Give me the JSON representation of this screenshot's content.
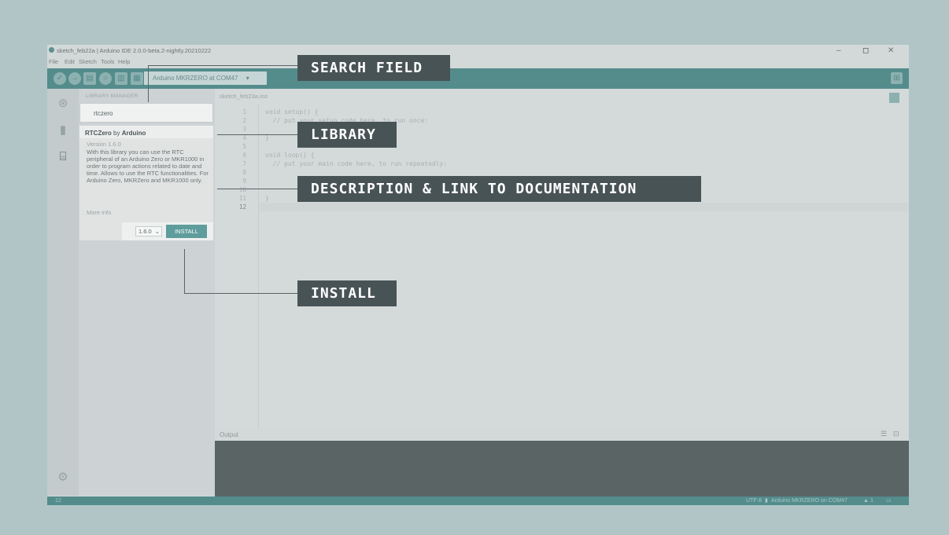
{
  "window": {
    "title": "sketch_feb22a | Arduino IDE 2.0.0-beta.2-nightly.20210222",
    "controls": {
      "minimize": "–",
      "maximize": "◻",
      "close": "✕"
    }
  },
  "menu": [
    "File",
    "Edit",
    "Sketch",
    "Tools",
    "Help"
  ],
  "toolbar": {
    "board": "Arduino MKRZERO at COM47",
    "board_caret": "▾"
  },
  "library_manager": {
    "title": "LIBRARY MANAGER",
    "search_value": "rtczero",
    "library": {
      "name": "RTCZero",
      "by": "by",
      "author": "Arduino",
      "version": "Version 1.6.0",
      "description": "With this library you can use the RTC peripheral of an Arduino Zero or MKR1000 in order to program actions related to date and time. Allows to use the RTC functionalities. For Arduino Zero, MKRZero and MKR1000 only.",
      "more_info": "More info",
      "selected_version": "1.6.0",
      "install_label": "INSTALL"
    }
  },
  "editor": {
    "tab": "sketch_feb23a.ino",
    "line_numbers": [
      "1",
      "2",
      "3",
      "4",
      "5",
      "6",
      "7",
      "8",
      "9",
      "10",
      "11",
      "12"
    ],
    "code_lines": [
      "void setup() {",
      "  // put your setup code here, to run once:",
      "",
      "}",
      "",
      "void loop() {",
      "  // put your main code here, to run repeatedly:",
      "",
      "",
      "",
      "}",
      ""
    ]
  },
  "output": {
    "label": "Output"
  },
  "status_bar": {
    "line": "12",
    "encoding": "UTF-8",
    "board": "Arduino MKRZERO on COM47",
    "notifications": "1"
  },
  "callouts": {
    "search_field": "SEARCH FIELD",
    "library": "LIBRARY",
    "description": "DESCRIPTION & LINK TO DOCUMENTATION",
    "install": "INSTALL"
  },
  "colors": {
    "toolbar": "#548c8c",
    "callout_bg": "#485356",
    "background": "#b1c5c7"
  }
}
